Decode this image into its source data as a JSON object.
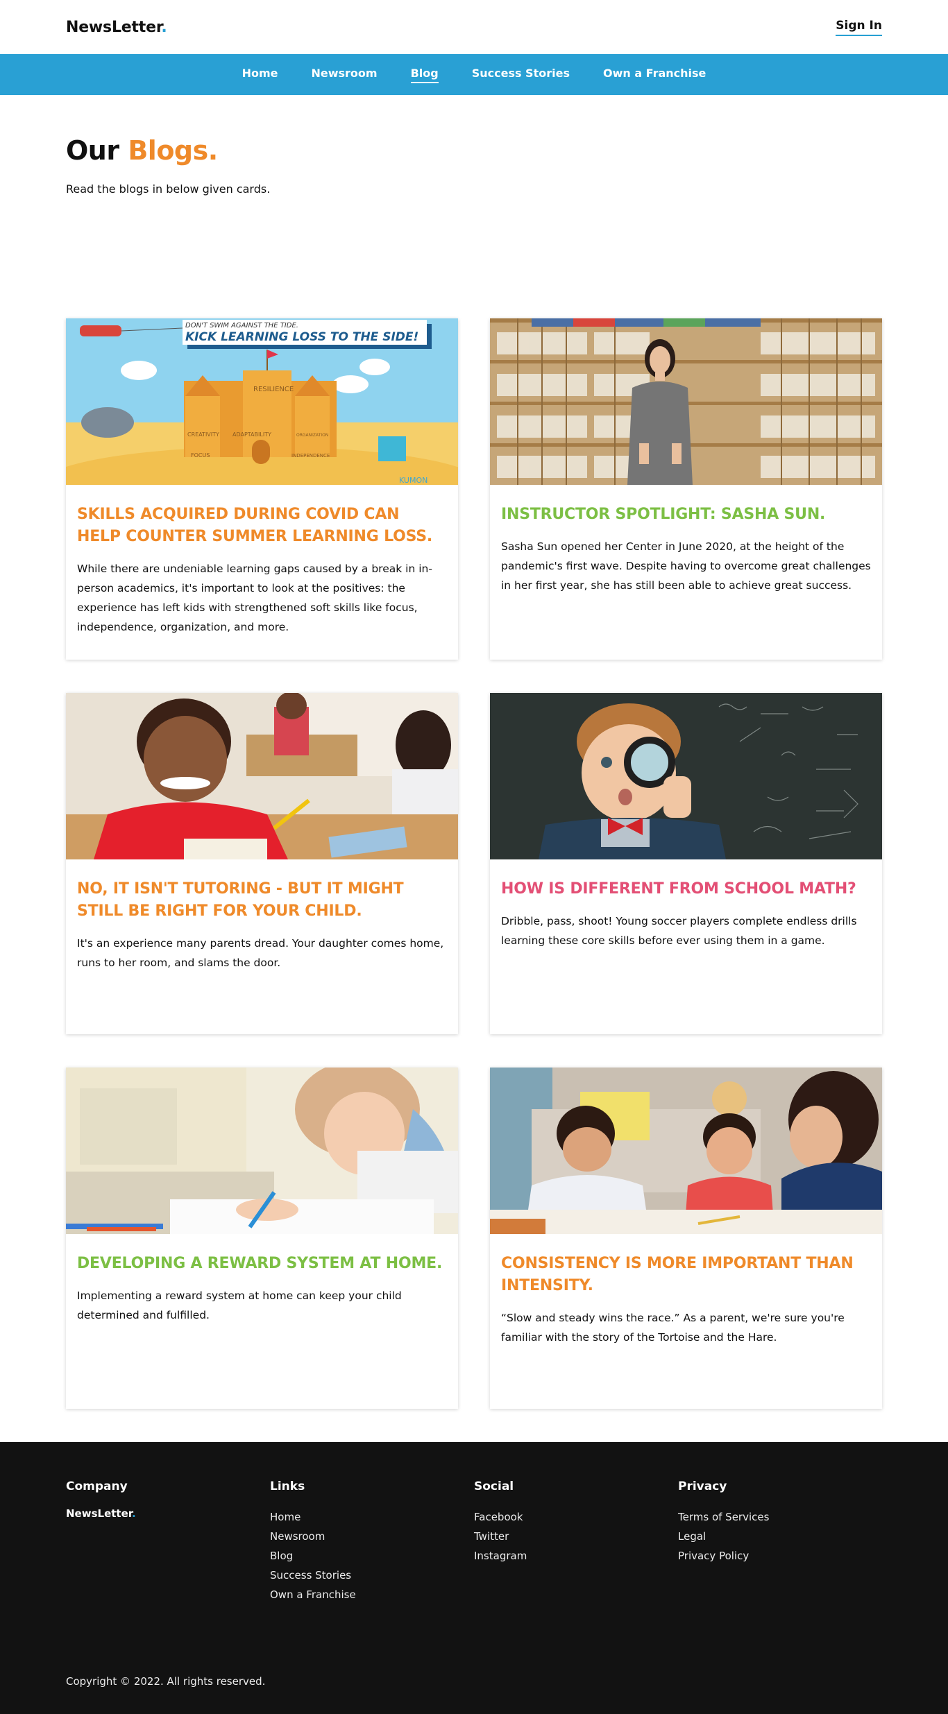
{
  "header": {
    "brand_name": "NewsLetter",
    "brand_dot": ".",
    "signin_label": "Sign In"
  },
  "nav": {
    "items": [
      "Home",
      "Newsroom",
      "Blog",
      "Success Stories",
      "Own a Franchise"
    ],
    "active": "Blog"
  },
  "page": {
    "title_main": "Our ",
    "title_accent": "Blogs.",
    "subtitle": "Read the blogs in below given cards."
  },
  "cards": [
    {
      "title": "SKILLS ACQUIRED DURING COVID CAN HELP COUNTER SUMMER LEARNING LOSS.",
      "text": "While there are undeniable learning gaps caused by a break in in-person academics, it's important to look at the positives: the experience has left kids with strengthened soft skills like focus, independence, organization, and more.",
      "title_color": "orange",
      "image_caption_top": "DON'T SWIM AGAINST THE TIDE.",
      "image_caption_main": "KICK LEARNING LOSS TO THE SIDE!",
      "image_labels": [
        "RESILIENCE",
        "CREATIVITY",
        "ADAPTABILITY",
        "ORGANIZATION",
        "FOCUS",
        "INDEPENDENCE"
      ],
      "image_logo": "KUMON"
    },
    {
      "title": "INSTRUCTOR SPOTLIGHT: SASHA SUN.",
      "text": "Sasha Sun opened her Center in June 2020, at the height of the pandemic's first wave. Despite having to overcome great challenges in her first year, she has still been able to achieve great success.",
      "title_color": "green"
    },
    {
      "title": "NO, IT ISN'T TUTORING - BUT IT MIGHT STILL BE RIGHT FOR YOUR CHILD.",
      "text": "It's an experience many parents dread. Your daughter comes home, runs to her room, and slams the door.",
      "title_color": "orange"
    },
    {
      "title": "HOW IS DIFFERENT FROM SCHOOL MATH?",
      "text": "Dribble, pass, shoot! Young soccer players complete endless drills learning these core skills before ever using them in a game.",
      "title_color": "pink"
    },
    {
      "title": "DEVELOPING A REWARD SYSTEM AT HOME.",
      "text": "Implementing a reward system at home can keep your child determined and fulfilled.",
      "title_color": "green"
    },
    {
      "title": "CONSISTENCY IS MORE IMPORTANT THAN INTENSITY.",
      "text": "“Slow and steady wins the race.” As a parent, we're sure you're familiar with the story of the Tortoise and the Hare.",
      "title_color": "orange"
    }
  ],
  "footer": {
    "company_heading": "Company",
    "company_brand": "NewsLetter",
    "company_dot": ".",
    "links_heading": "Links",
    "links": [
      "Home",
      "Newsroom",
      "Blog",
      "Success Stories",
      "Own a Franchise"
    ],
    "social_heading": "Social",
    "social": [
      "Facebook",
      "Twitter",
      "Instagram"
    ],
    "privacy_heading": "Privacy",
    "privacy": [
      "Terms of Services",
      "Legal",
      "Privacy Policy"
    ],
    "copyright": "Copyright © 2022. All rights reserved."
  },
  "colors": {
    "accent_blue": "#29a0d4",
    "accent_orange": "#ef8a2a",
    "accent_green": "#7cbf44",
    "accent_pink": "#e34f75",
    "footer_bg": "#121212"
  }
}
